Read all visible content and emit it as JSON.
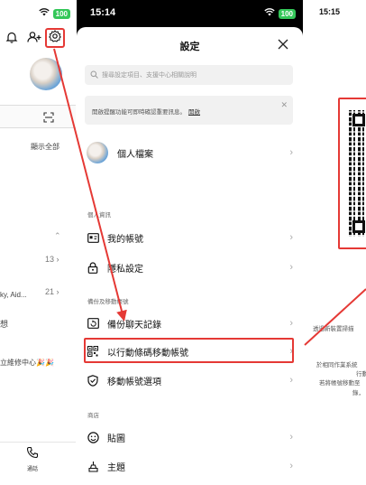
{
  "left_panel": {
    "battery": "100",
    "show_all": "顯示全部",
    "count_13": "13",
    "text_sky": "ky, Aid...",
    "count_21": "21",
    "text_fragment": "想",
    "text_repair": "立維修中心🎉🎉",
    "bottom_tab_label": "通話"
  },
  "middle_panel": {
    "time": "15:14",
    "battery": "100",
    "title": "設定",
    "search_placeholder": "搜尋設定項目、支援中心相關說明",
    "notice_text": "開啟提醒功能可即時確認重要訊息。",
    "notice_link": "開啟",
    "profile_label": "個人檔案",
    "section_personal": "個人資訊",
    "my_account": "我的帳號",
    "privacy": "隱私設定",
    "section_backup": "備份及移動帳號",
    "backup_chats": "備份聊天記錄",
    "qr_transfer": "以行動條碼移動帳號",
    "transfer_options": "移動帳號選項",
    "section_shop": "商店",
    "stickers": "貼圖",
    "themes": "主題"
  },
  "right_panel": {
    "time": "15:15",
    "line1": "透過新裝置掃描",
    "line2": "於相同作業系統",
    "line3": "行動",
    "line4": "若將帳號移動至",
    "line5": "錄，"
  },
  "colors": {
    "highlight": "#e53935",
    "battery": "#34c759"
  }
}
